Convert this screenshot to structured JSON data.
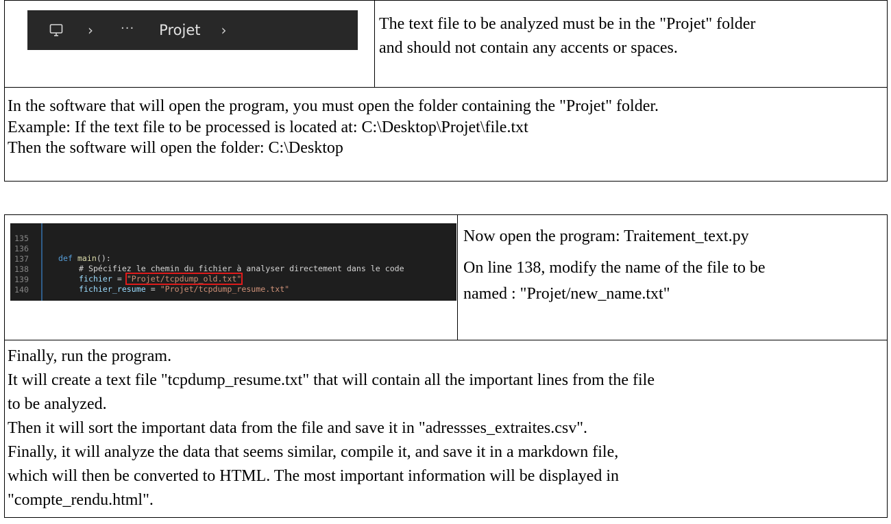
{
  "section1": {
    "breadcrumb": {
      "icon": "computer-icon",
      "separator": "›",
      "ellipsis": "···",
      "folder": "Projet"
    },
    "note_lines": [
      "The text file to be analyzed must be in the \"Projet\" folder",
      "and should not contain any accents or spaces."
    ],
    "instructions": [
      "In the software that will open the program, you must open the folder containing the \"Projet\" folder.",
      "Example: If the text file to be processed is located at: C:\\Desktop\\Projet\\file.txt",
      "Then the software will open the folder: C:\\Desktop"
    ]
  },
  "section2": {
    "code": {
      "lines": [
        {
          "num": "135"
        },
        {
          "num": "136",
          "kw": "def",
          "fn": "main",
          "rest": "():"
        },
        {
          "num": "137",
          "comment": "# Spécifiez le chemin du fichier à analyser directement dans le code"
        },
        {
          "num": "138",
          "var": "fichier",
          "op": " = ",
          "str": "\"Projet/tcpdump_old.txt\""
        },
        {
          "num": "139",
          "var": "fichier_resume",
          "op": " = ",
          "str": "\"Projet/tcpdump_resume.txt\""
        },
        {
          "num": "140"
        }
      ],
      "highlight_color": "#e01b1b"
    },
    "note_line1": "Now open the program: Traitement_text.py",
    "note_line2": "On line 138, modify the name of the file to be",
    "note_line3": "named : \"Projet/new_name.txt\"",
    "final_lines": [
      "Finally, run the program.",
      "It will create a text file \"tcpdump_resume.txt\" that will contain all the important lines from the file",
      "to be analyzed.",
      "Then it will sort the important data from the file and save it in \"adressses_extraites.csv\".",
      "Finally, it will analyze the data that seems similar, compile it, and save it in a markdown file,",
      "which will then be converted to HTML. The most important information will be displayed in",
      "\"compte_rendu.html\"."
    ]
  }
}
